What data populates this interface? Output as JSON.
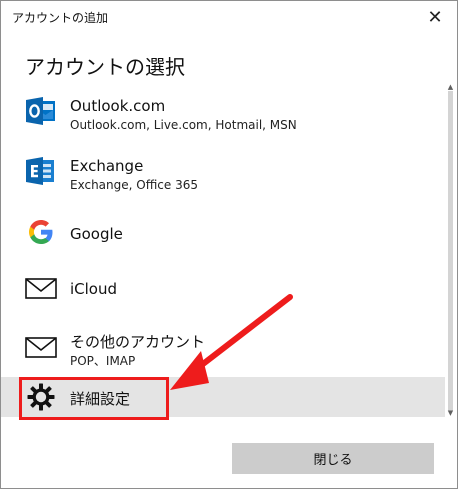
{
  "window": {
    "title": "アカウントの追加",
    "close_glyph": "✕"
  },
  "heading": "アカウントの選択",
  "accounts": [
    {
      "name": "Outlook.com",
      "sub": "Outlook.com, Live.com, Hotmail, MSN",
      "icon": "outlook-icon"
    },
    {
      "name": "Exchange",
      "sub": "Exchange, Office 365",
      "icon": "exchange-icon"
    },
    {
      "name": "Google",
      "sub": "",
      "icon": "google-icon"
    },
    {
      "name": "iCloud",
      "sub": "",
      "icon": "mail-envelope-icon"
    },
    {
      "name": "その他のアカウント",
      "sub": "POP、IMAP",
      "icon": "mail-envelope-icon"
    }
  ],
  "advanced": {
    "label": "詳細設定",
    "icon": "gear-icon"
  },
  "footer": {
    "close_label": "閉じる"
  },
  "colors": {
    "outlook_blue": "#0072c6",
    "exchange_blue": "#0a64ad",
    "highlight_red": "#ee1c1c",
    "selected_row_bg": "#e4e4e4",
    "button_bg": "#cccccc"
  }
}
